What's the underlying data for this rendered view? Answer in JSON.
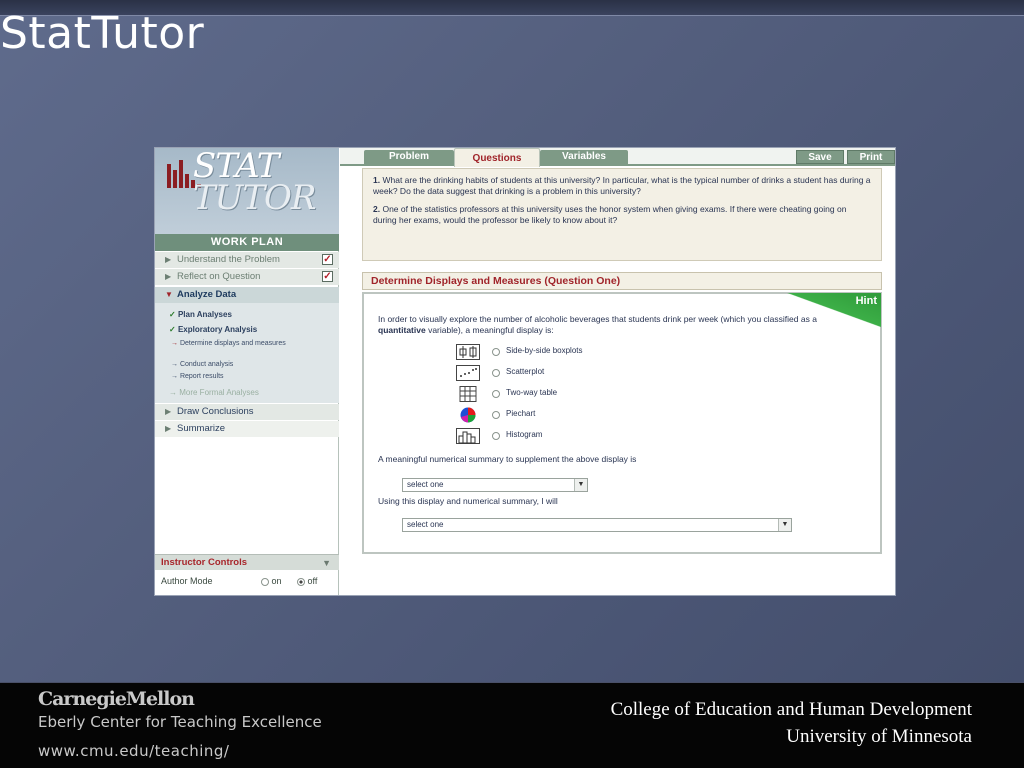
{
  "slide": {
    "title": "StatTutor"
  },
  "app": {
    "logo_text_top": "STAT",
    "logo_text_bottom": "TUTOR",
    "work_plan_label": "WORK PLAN",
    "tabs": [
      {
        "label": "Problem",
        "active": false
      },
      {
        "label": "Questions",
        "active": true
      },
      {
        "label": "Variables",
        "active": false
      }
    ],
    "save_label": "Save",
    "print_label": "Print",
    "sidebar": {
      "items": [
        {
          "label": "Understand the Problem",
          "checked": true
        },
        {
          "label": "Reflect on Question",
          "checked": true
        },
        {
          "label": "Analyze Data",
          "expanded": true
        },
        {
          "label": "Draw Conclusions"
        },
        {
          "label": "Summarize"
        }
      ],
      "subitems": [
        {
          "label": "Plan Analyses",
          "mark": "✓"
        },
        {
          "label": "Exploratory Analysis",
          "mark": "✓"
        },
        {
          "label": "Determine displays and measures",
          "mark": "→"
        },
        {
          "label": "Conduct analysis",
          "mark": "→"
        },
        {
          "label": "Report results",
          "mark": "→"
        },
        {
          "label": "More Formal Analyses",
          "mark": "→"
        }
      ],
      "instructor_controls_label": "Instructor Controls",
      "author_mode_label": "Author Mode",
      "author_on_label": "on",
      "author_off_label": "off",
      "author_mode_value": "off"
    },
    "questions": {
      "q1_number": "1.",
      "q1_text": "What are the drinking habits of students at this university? In particular, what is the typical number of drinks a student has during a week? Do the data suggest that drinking is a problem in this university?",
      "q2_number": "2.",
      "q2_text": "One of the statistics professors at this university uses the honor system when giving exams. If there were cheating going on during her exams, would the professor be likely to know about it?"
    },
    "section_title": "Determine Displays and Measures (Question One)",
    "hint_label": "Hint",
    "intro_before": "In order to visually explore the number of alcoholic beverages that students drink per week (which you classified as a ",
    "intro_bold": "quantitative",
    "intro_after": " variable), a meaningful display is:",
    "display_options": [
      {
        "label": "Side-by-side boxplots",
        "icon": "boxplot-icon"
      },
      {
        "label": "Scatterplot",
        "icon": "scatterplot-icon"
      },
      {
        "label": "Two-way table",
        "icon": "table-icon"
      },
      {
        "label": "Piechart",
        "icon": "piechart-icon"
      },
      {
        "label": "Histogram",
        "icon": "histogram-icon"
      }
    ],
    "summary_label": "A meaningful numerical summary to supplement the above display is",
    "summary_select_value": "select one",
    "using_label": "Using this display and numerical summary, I will",
    "using_select_value": "select one"
  },
  "footer": {
    "cmu_logo_text": "CarnegieMellon",
    "center_name": "Eberly Center for Teaching Excellence",
    "url": "www.cmu.edu/teaching/",
    "college_line1": "College of Education and Human Development",
    "college_line2": "University of Minnesota"
  },
  "colors": {
    "accent_red": "#a0242a",
    "tab_green": "#7e9a86",
    "hint_green": "#3caf47",
    "slide_bg": "#55607f"
  }
}
